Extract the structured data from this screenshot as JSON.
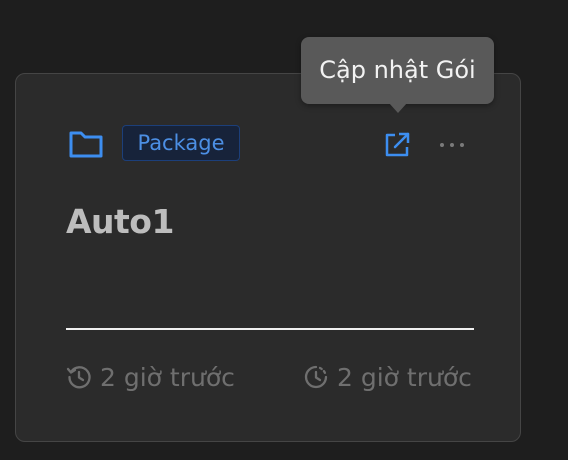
{
  "card": {
    "type_badge": "Package",
    "title": "Auto1",
    "created_text": "2 giờ trước",
    "updated_text": "2 giờ trước"
  },
  "tooltip": {
    "text": "Cập nhật Gói"
  },
  "icons": {
    "folder": "folder-icon",
    "open": "external-link-icon",
    "more": "more-horizontal-icon",
    "history": "history-icon",
    "clock": "clock-icon"
  },
  "colors": {
    "background": "#1e1e1e",
    "card": "#2b2b2b",
    "accent": "#4c8fe4",
    "badge_bg": "#17233a",
    "muted": "#6f6f6f",
    "tooltip_bg": "#595959"
  }
}
